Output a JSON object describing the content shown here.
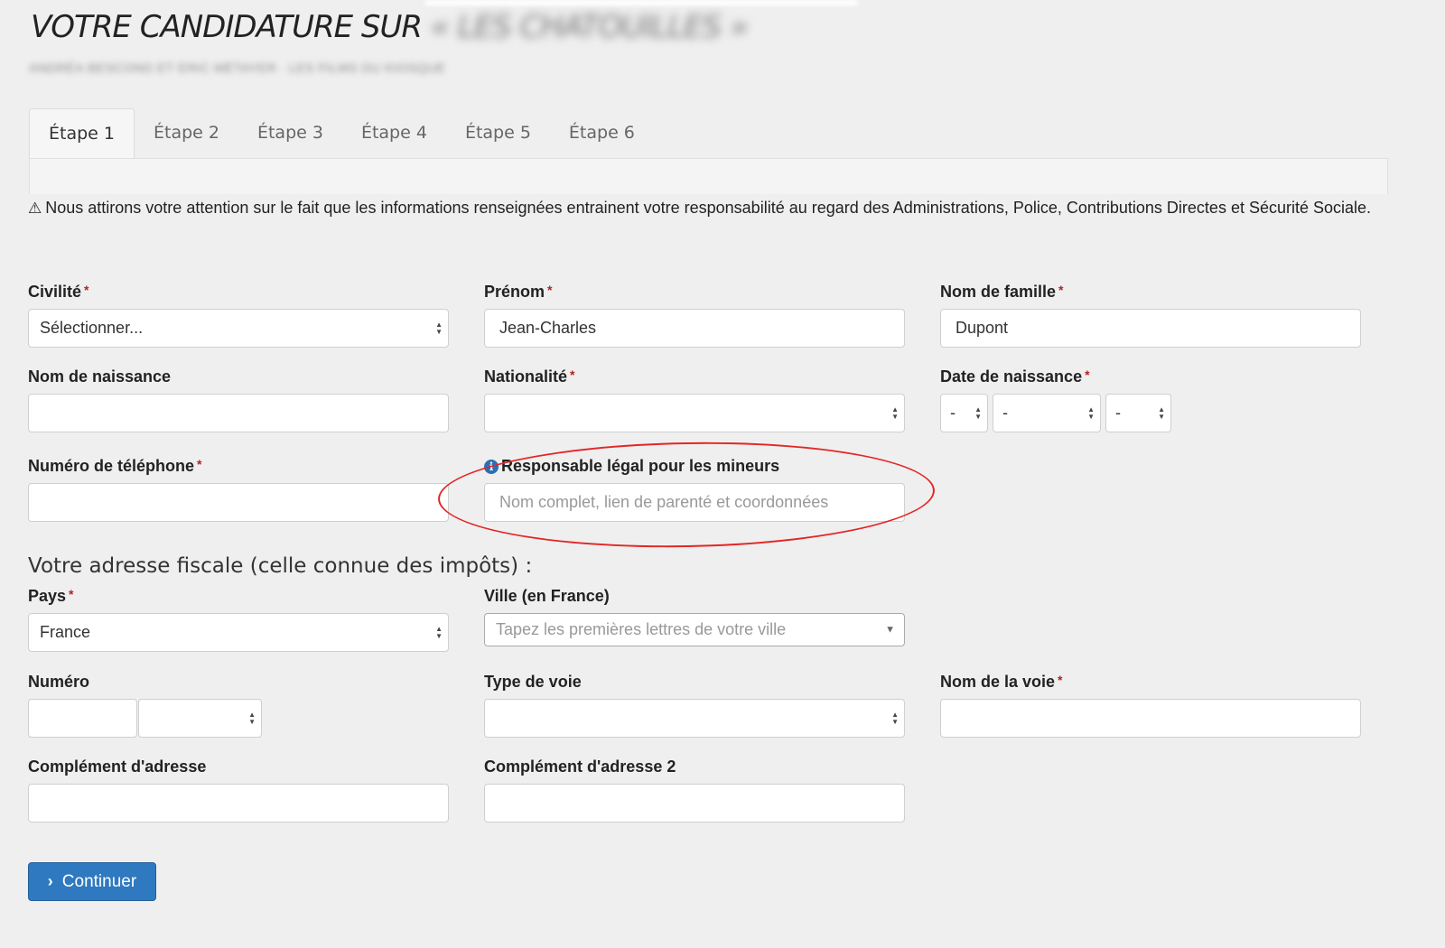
{
  "header": {
    "title": "VOTRE CANDIDATURE SUR",
    "title_blurred": "« LES CHATOUILLES »",
    "subtitle_blurred": "ANDRÉA BESCOND ET ERIC MÉTAYER · LES FILMS DU KIOSQUE"
  },
  "tabs": [
    {
      "label": "Étape 1",
      "active": true
    },
    {
      "label": "Étape 2",
      "active": false
    },
    {
      "label": "Étape 3",
      "active": false
    },
    {
      "label": "Étape 4",
      "active": false
    },
    {
      "label": "Étape 5",
      "active": false
    },
    {
      "label": "Étape 6",
      "active": false
    }
  ],
  "warning": {
    "icon": "warning-triangle-icon",
    "text": "Nous attirons votre attention sur le fait que les informations renseignées entrainent votre responsabilité au regard des Administrations, Police, Contributions Directes et Sécurité Sociale."
  },
  "required_marker": "*",
  "fields": {
    "civilite": {
      "label": "Civilité",
      "value": "Sélectionner..."
    },
    "prenom": {
      "label": "Prénom",
      "value": "Jean-Charles"
    },
    "nom_famille": {
      "label": "Nom de famille",
      "value": "Dupont"
    },
    "nom_naissance": {
      "label": "Nom de naissance",
      "value": ""
    },
    "nationalite": {
      "label": "Nationalité",
      "value": ""
    },
    "date_naissance": {
      "label": "Date de naissance",
      "day": "-",
      "month": "-",
      "year": "-"
    },
    "telephone": {
      "label": "Numéro de téléphone",
      "value": ""
    },
    "responsable": {
      "label": "Responsable légal pour les mineurs",
      "info_icon": "i",
      "placeholder": "Nom complet, lien de parenté et coordonnées"
    }
  },
  "address": {
    "heading": "Votre adresse fiscale (celle connue des impôts) :",
    "pays": {
      "label": "Pays",
      "value": "France"
    },
    "ville": {
      "label": "Ville (en France)",
      "placeholder": "Tapez les premières lettres de votre ville"
    },
    "numero": {
      "label": "Numéro",
      "value": "",
      "suffix": ""
    },
    "type_voie": {
      "label": "Type de voie",
      "value": ""
    },
    "nom_voie": {
      "label": "Nom de la voie",
      "value": ""
    },
    "complement": {
      "label": "Complément d'adresse",
      "value": ""
    },
    "complement2": {
      "label": "Complément d'adresse 2",
      "value": ""
    }
  },
  "actions": {
    "continue_label": "Continuer"
  },
  "colors": {
    "background": "#efefef",
    "primary_button": "#2f79c0",
    "required": "#b52121",
    "annotation_ellipse": "#e32626",
    "info_icon": "#2b6fb5"
  }
}
